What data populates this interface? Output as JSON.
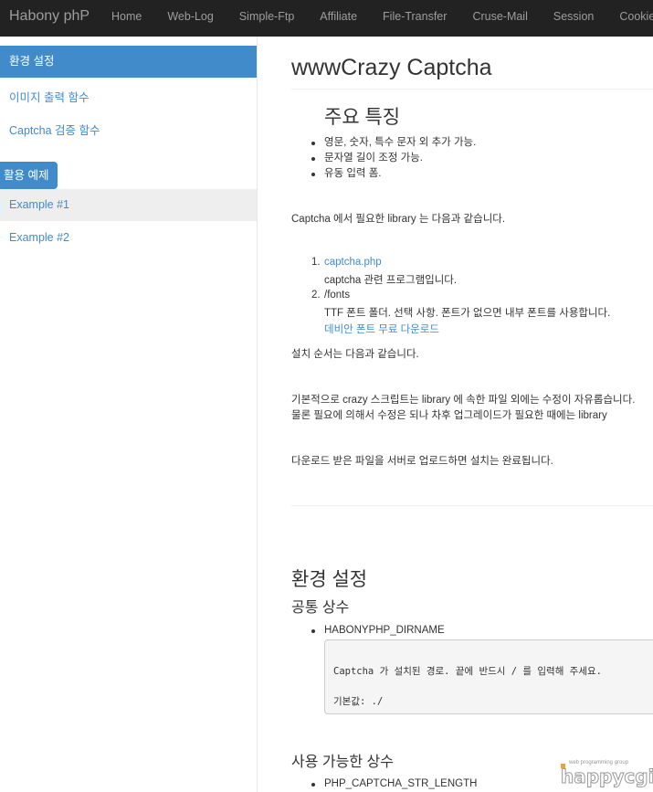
{
  "navbar": {
    "brand": "Habony phP",
    "items": [
      "Home",
      "Web-Log",
      "Simple-Ftp",
      "Affiliate",
      "File-Transfer",
      "Cruse-Mail",
      "Session",
      "Cookie"
    ]
  },
  "sidebar": {
    "header": "환경 설정",
    "links": [
      "이미지 출력 함수",
      "Captcha 검증 함수"
    ],
    "section": "활용 예제",
    "active": "Example #1",
    "example2": "Example #2"
  },
  "main": {
    "title": "wwwCrazy Captcha",
    "features_heading": "주요 특징",
    "features": [
      "영문, 숫자, 특수 문자 외 추가 가능.",
      "문자열 길이 조정 가능.",
      "유동 입력 폼."
    ],
    "library_intro": "Captcha 에서 필요한 library 는 다음과 같습니다.",
    "lib1_num": "1.",
    "lib1_link": "captcha.php",
    "lib1_desc": "captcha 관련 프로그램입니다.",
    "lib2_num": "2.",
    "lib2_name": "/fonts",
    "lib2_desc": "TTF 폰트 폴더. 선택 사항. 폰트가 없으면 내부 폰트를 사용합니다.",
    "lib2_link": "데비안 폰트 무료 다운로드",
    "install_intro": "설치 순서는 다음과 같습니다.",
    "basic1": "기본적으로 crazy 스크립트는 library 에 속한 파일 외에는 수정이 자유롭습니다.",
    "basic2": "물론 필요에 의해서 수정은 되나 차후 업그레이드가 필요한 때에는 library",
    "upload": "다운로드 받은 파일을 서버로 업로드하면 설치는 완료됩니다.",
    "config_heading": "환경 설정",
    "common_heading": "공통 상수",
    "const1": "HABONYPHP_DIRNAME",
    "code_line1": "Captcha 가 설치된 경로. 끝에 반드시 / 를 입력해 주세요.",
    "code_line2": "기본값: ./",
    "avail_heading": "사용 가능한 상수",
    "const2": "PHP_CAPTCHA_STR_LENGTH"
  },
  "watermark": {
    "small": "web programming group",
    "big": "happycgi"
  }
}
